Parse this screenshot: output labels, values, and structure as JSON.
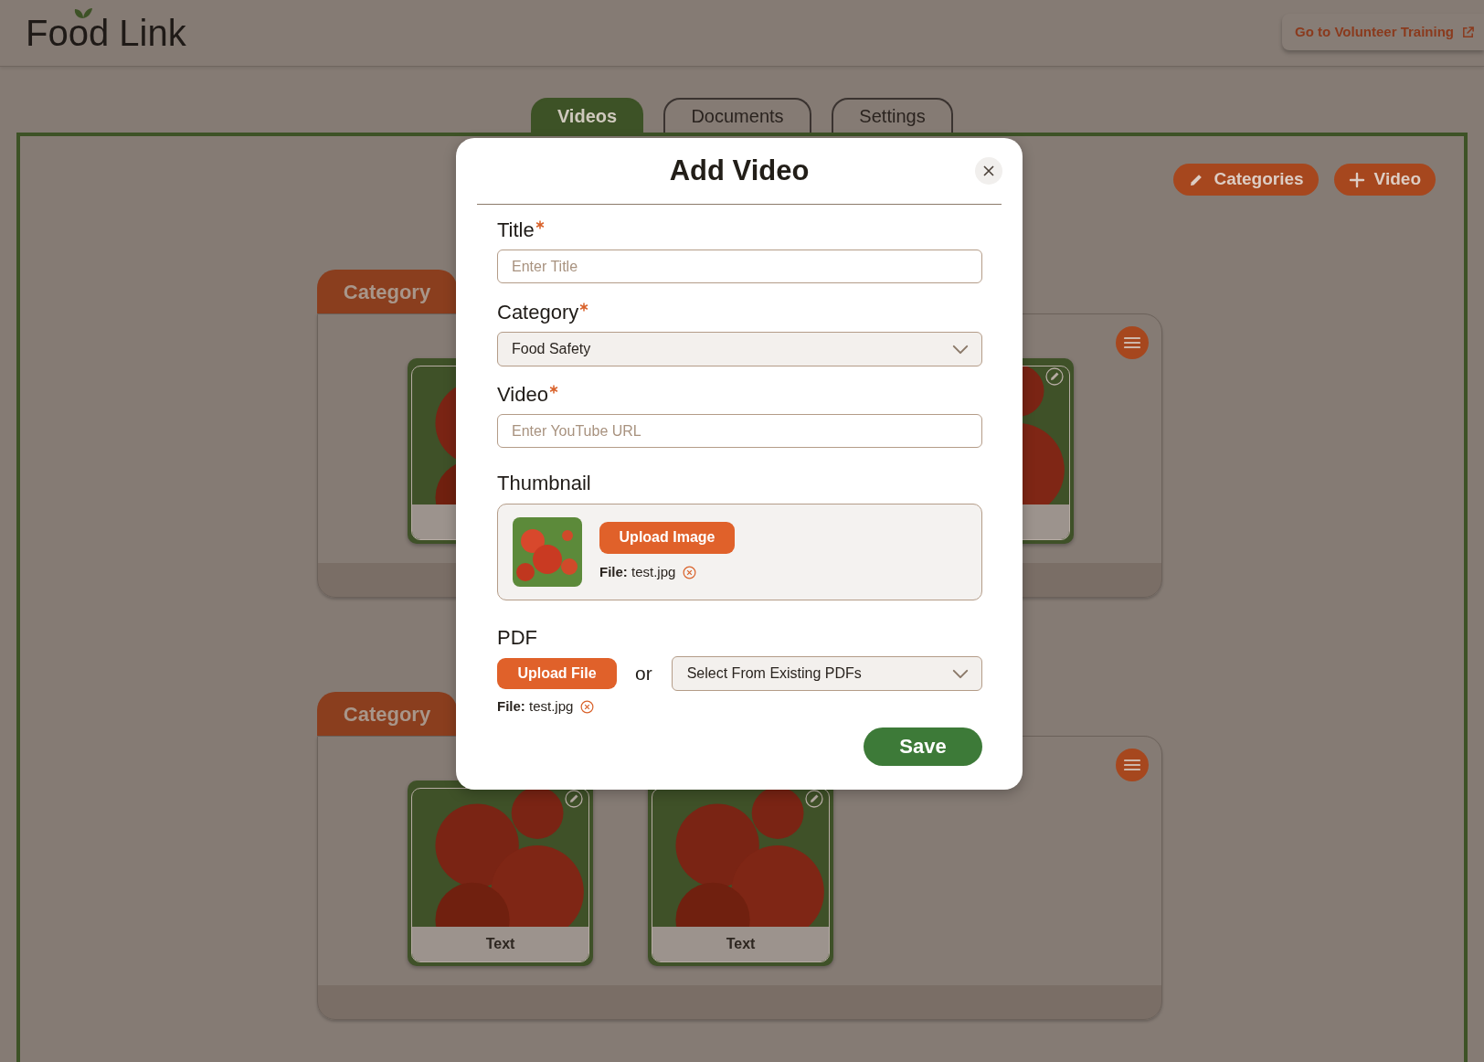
{
  "header": {
    "logo": "Food Link",
    "training_link": "Go to Volunteer Training"
  },
  "tabs": [
    {
      "label": "Videos",
      "selected": true
    },
    {
      "label": "Documents",
      "selected": false
    },
    {
      "label": "Settings",
      "selected": false
    }
  ],
  "actions": [
    {
      "label": "Categories",
      "kind": "edit"
    },
    {
      "label": "Video",
      "kind": "add"
    }
  ],
  "categories": [
    {
      "title": "Category",
      "kind": "covered",
      "videos": [
        {
          "edit_icon": false
        },
        {
          "edit_icon": true
        }
      ]
    },
    {
      "title": "Category",
      "kind": "open",
      "videos": [
        {
          "edit_icon": true,
          "caption": "Text"
        },
        {
          "edit_icon": true,
          "caption": "Text"
        }
      ]
    }
  ],
  "modal": {
    "title": "Add Video",
    "fields": [
      {
        "kind": "text",
        "label": "Title",
        "required": true,
        "placeholder": "Enter Title"
      },
      {
        "kind": "select",
        "label": "Category",
        "required": true,
        "value": "Food Safety"
      },
      {
        "kind": "text",
        "label": "Video",
        "required": true,
        "placeholder": "Enter YouTube URL"
      },
      {
        "kind": "image",
        "label": "Thumbnail",
        "required": false,
        "button": "Upload Image",
        "file": "**File:** test.jpg"
      },
      {
        "kind": "pdf",
        "label": "PDF",
        "required": false,
        "button": "Upload File",
        "separator": "or",
        "value": "Select From Existing PDFs",
        "file": "**File:** test.jpg"
      }
    ],
    "save": "Save"
  }
}
